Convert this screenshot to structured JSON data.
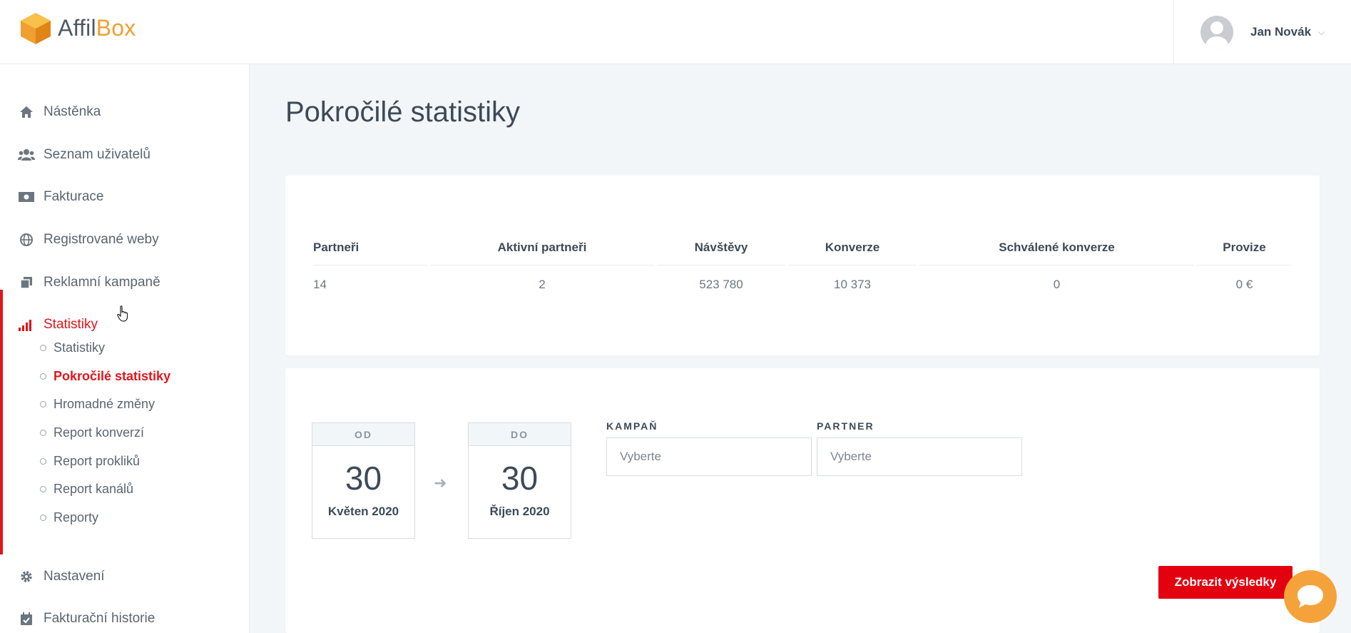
{
  "brand": {
    "part1": "Affil",
    "part2": "Box",
    "cube_colors": [
      "#f9b233",
      "#f0a030",
      "#e8891c"
    ]
  },
  "user": {
    "name": "Jan Novák"
  },
  "sidebar": {
    "items": [
      {
        "label": "Nástěnka",
        "icon": "home-icon"
      },
      {
        "label": "Seznam uživatelů",
        "icon": "users-icon"
      },
      {
        "label": "Fakturace",
        "icon": "money-icon"
      },
      {
        "label": "Registrované weby",
        "icon": "globe-icon"
      },
      {
        "label": "Reklamní kampaně",
        "icon": "copy-icon"
      },
      {
        "label": "Statistiky",
        "icon": "signal-icon",
        "active": true
      },
      {
        "label": "Nastavení",
        "icon": "gear-icon"
      },
      {
        "label": "Fakturační historie",
        "icon": "calendar-check-icon"
      }
    ],
    "subitems": [
      {
        "label": "Statistiky"
      },
      {
        "label": "Pokročilé statistiky",
        "active": true
      },
      {
        "label": "Hromadné změny"
      },
      {
        "label": "Report konverzí"
      },
      {
        "label": "Report prokliků"
      },
      {
        "label": "Report kanálů"
      },
      {
        "label": "Reporty"
      }
    ]
  },
  "main": {
    "title": "Pokročilé statistiky",
    "stats": {
      "headers": [
        "Partneři",
        "Aktivní partneři",
        "Návštěvy",
        "Konverze",
        "Schválené konverze",
        "Provize"
      ],
      "values": [
        "14",
        "2",
        "523 780",
        "10 373",
        "0",
        "0 €"
      ]
    },
    "filter": {
      "from": {
        "label": "OD",
        "day": "30",
        "month": "Květen 2020"
      },
      "to": {
        "label": "DO",
        "day": "30",
        "month": "Říjen 2020"
      },
      "campaign": {
        "label": "KAMPAŇ",
        "placeholder": "Vyberte"
      },
      "partner": {
        "label": "PARTNER",
        "placeholder": "Vyberte"
      },
      "submit_label": "Zobrazit výsledky"
    }
  },
  "colors": {
    "accent": "#e3141c",
    "button": "#e3000f",
    "chat": "#f6a23a",
    "brand_orange": "#f0a030"
  }
}
